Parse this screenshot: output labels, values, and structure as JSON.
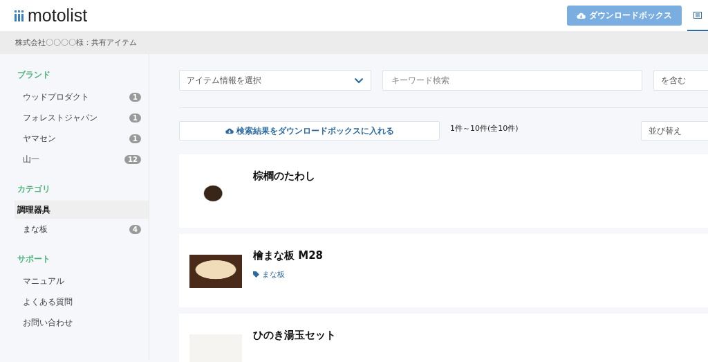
{
  "header": {
    "logo": "motolist",
    "download_button": "ダウンロードボックス",
    "tabs": [
      {
        "selected": true
      }
    ]
  },
  "breadcrumb": "株式会社〇〇〇〇様：共有アイテム",
  "sidebar": {
    "sections": [
      {
        "title": "ブランド",
        "items": [
          {
            "label": "ウッドプロダクト",
            "count": "1",
            "selected": false
          },
          {
            "label": "フォレストジャパン",
            "count": "1",
            "selected": false
          },
          {
            "label": "ヤマセン",
            "count": "1",
            "selected": false
          },
          {
            "label": "山一",
            "count": "12",
            "selected": false
          }
        ]
      },
      {
        "title": "カテゴリ",
        "items": [
          {
            "label": "調理器具",
            "selected": true,
            "children": [
              {
                "label": "まな板",
                "count": "4",
                "selected": false
              }
            ]
          }
        ]
      },
      {
        "title": "サポート",
        "items": [
          {
            "label": "マニュアル",
            "selected": false
          },
          {
            "label": "よくある質問",
            "selected": false
          },
          {
            "label": "お問い合わせ",
            "selected": false
          }
        ]
      }
    ]
  },
  "filters": {
    "field_select": "アイテム情報を選択",
    "keyword": {
      "placeholder": "キーワード検索"
    },
    "match_select": "を含む"
  },
  "results": {
    "download_button": "検索結果をダウンロードボックスに入れる",
    "count": "1件～10件(全10件)",
    "sort_select": "並び替え"
  },
  "items": [
    {
      "title": "棕櫚のたわし"
    },
    {
      "title": "檜まな板 M28",
      "tags": [
        "まな板"
      ]
    },
    {
      "title": "ひのき湯玉セット"
    }
  ]
}
